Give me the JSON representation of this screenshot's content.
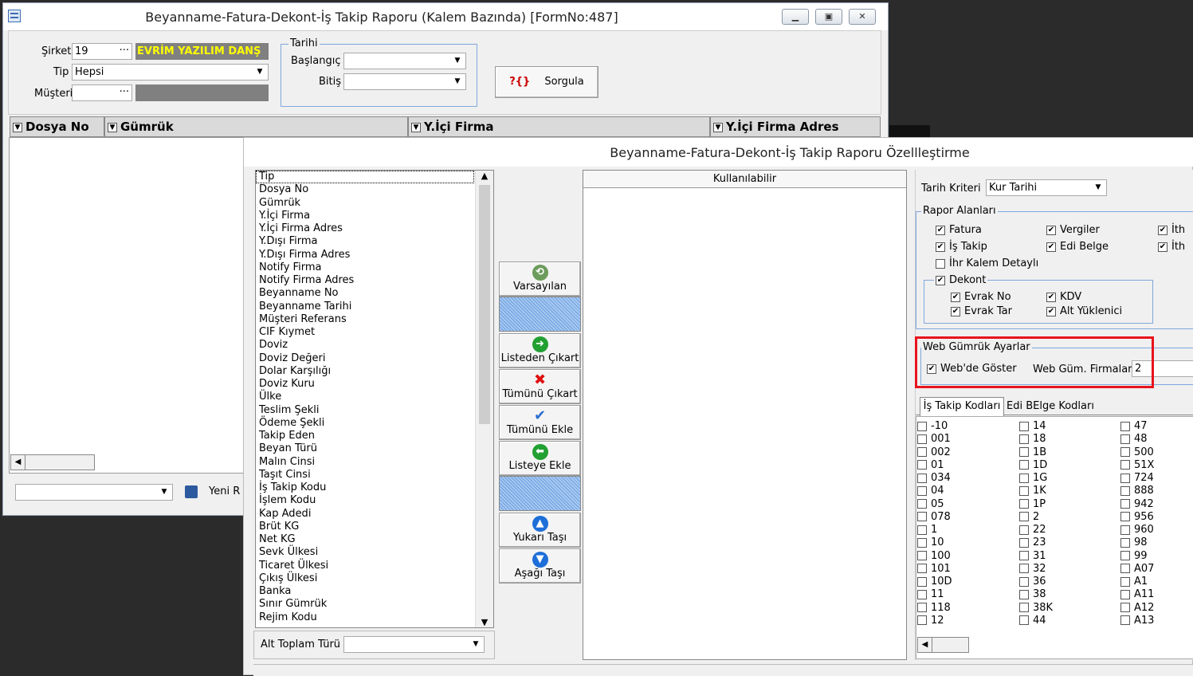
{
  "main": {
    "title": "Beyanname-Fatura-Dekont-İş Takip Raporu (Kalem Bazında) [FormNo:487]",
    "sirket_label": "Şirket",
    "sirket_value": "19",
    "sirket_name": "EVRİM YAZILIM DANŞ",
    "tip_label": "Tip",
    "tip_value": "Hepsi",
    "musteri_label": "Müşteri",
    "tarihi_group": "Tarihi",
    "baslangic_label": "Başlangıç",
    "bitis_label": "Bitiş",
    "sorgula": "Sorgula",
    "ellipsis": "···",
    "columns": [
      "Dosya No",
      "Gümrük",
      "Y.İçi Firma",
      "Y.İçi Firma Adres"
    ],
    "yeni_label": "Yeni R"
  },
  "dialog": {
    "title": "Beyanname-Fatura-Dekont-İş Takip Raporu Özellleştirme",
    "fields": [
      "Tip",
      "Dosya No",
      "Gümrük",
      "Y.İçi Firma",
      "Y.İçi Firma Adres",
      "Y.Dışı Firma",
      "Y.Dışı Firma Adres",
      "Notify Firma",
      "Notify Firma Adres",
      "Beyanname No",
      "Beyanname Tarihi",
      "Müşteri Referans",
      "CIF Kıymet",
      "Doviz",
      "Doviz Değeri",
      "Dolar Karşılığı",
      "Doviz Kuru",
      "Ülke",
      "Teslim Şekli",
      "Ödeme Şekli",
      "Takip Eden",
      "Beyan Türü",
      "Malın Cinsi",
      "Taşıt Cinsi",
      "İş Takip Kodu",
      "İşlem Kodu",
      "Kap Adedi",
      "Brüt KG",
      "Net KG",
      "Sevk Ülkesi",
      "Ticaret Ülkesi",
      "Çıkış Ülkesi",
      "Banka",
      "Sınır Gümrük",
      "Rejim Kodu"
    ],
    "alt_toplam_label": "Alt Toplam Türü",
    "buttons": {
      "varsayilan": "Varsayılan",
      "listeden_cikart": "Listeden Çıkart",
      "tumunu_cikart": "Tümünü Çıkart",
      "tumunu_ekle": "Tümünü Ekle",
      "listeye_ekle": "Listeye Ekle",
      "yukari_tasi": "Yukarı Taşı",
      "asagi_tasi": "Aşağı Taşı"
    },
    "kullanilabilir": "Kullanılabilir",
    "tarih_kriteri_label": "Tarih Kriteri",
    "tarih_kriteri_value": "Kur Tarihi",
    "rapor_alanlari": "Rapor Alanları",
    "fatura": "Fatura",
    "vergiler": "Vergiler",
    "is_takip": "İş Takip",
    "edi_belge": "Edi Belge",
    "ith1": "İth",
    "ith2": "İth",
    "ihr_kalem": "İhr Kalem Detaylı",
    "dekont": "Dekont",
    "evrak_no": "Evrak No",
    "kdv": "KDV",
    "evrak_tar": "Evrak Tar",
    "alt_yuklenici": "Alt Yüklenici",
    "web_group": "Web Gümrük Ayarlar",
    "web_goster": "Web'de Göster",
    "web_gum_firmalar": "Web Güm. Firmalar",
    "web_gum_value": "2",
    "tabs": [
      "İş Takip Kodları",
      "Edi BElge Kodları"
    ],
    "codes_col1": [
      "-10",
      "001",
      "002",
      "01",
      "034",
      "04",
      "05",
      "078",
      "1",
      "10",
      "100",
      "101",
      "10D",
      "11",
      "118",
      "12"
    ],
    "codes_col2": [
      "14",
      "18",
      "1B",
      "1D",
      "1G",
      "1K",
      "1P",
      "2",
      "22",
      "23",
      "31",
      "32",
      "36",
      "38",
      "38K",
      "44"
    ],
    "codes_col3": [
      "47",
      "48",
      "500",
      "51X",
      "724",
      "888",
      "942",
      "956",
      "960",
      "98",
      "99",
      "A07",
      "A1",
      "A11",
      "A12",
      "A13"
    ]
  },
  "colors": {
    "highlight": "#e8141c",
    "sirket_bg": "#808080",
    "sirket_fg": "#ffff00"
  }
}
